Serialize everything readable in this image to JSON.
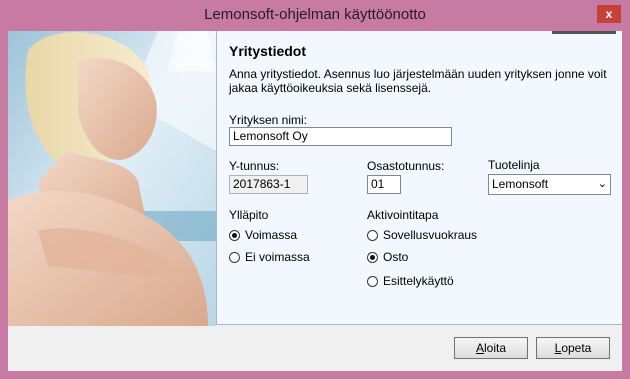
{
  "window": {
    "title": "Lemonsoft-ohjelman käyttöönotto",
    "close_glyph": "x"
  },
  "panel": {
    "heading": "Yritystiedot",
    "description": "Anna yritystiedot. Asennus luo järjestelmään uuden yrityksen jonne voit jakaa käyttöoikeuksia sekä lisenssejä."
  },
  "form": {
    "company_name_label": "Yrityksen nimi:",
    "company_name_value": "Lemonsoft Oy",
    "business_id_label": "Y-tunnus:",
    "business_id_value": "2017863-1",
    "dept_label": "Osastotunnus:",
    "dept_value": "01",
    "product_line_label": "Tuotelinja",
    "product_line_value": "Lemonsoft"
  },
  "maintenance": {
    "label": "Ylläpito",
    "options": [
      {
        "label": "Voimassa",
        "checked": true
      },
      {
        "label": "Ei voimassa",
        "checked": false
      }
    ]
  },
  "activation": {
    "label": "Aktivointitapa",
    "options": [
      {
        "label": "Sovellusvuokraus",
        "checked": false
      },
      {
        "label": "Osto",
        "checked": true
      },
      {
        "label": "Esittelykäyttö",
        "checked": false
      }
    ]
  },
  "buttons": {
    "start_first": "A",
    "start_rest": "loita",
    "quit_first": "L",
    "quit_rest": "opeta"
  },
  "colors": {
    "frame": "#c87ba2",
    "panel": "#f2f8fd",
    "close": "#c7403a"
  }
}
